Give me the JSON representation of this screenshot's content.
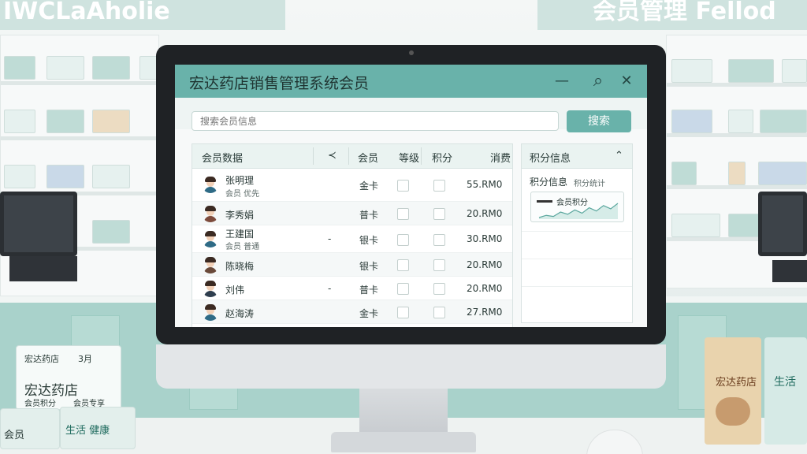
{
  "scene": {
    "sign_left": "IWCLaAholie",
    "sign_right": "会员管理 Fellod",
    "card": {
      "brand": "宏达药店",
      "logo_text": "宏达药店",
      "date": "3月",
      "footer_left": "会员积分",
      "footer_right": "会员专享"
    },
    "boxes": [
      "生活 健康",
      "会员"
    ],
    "product_left": "宏达药店",
    "product_right": "生活"
  },
  "app": {
    "title": "宏达药店销售管理系统会员",
    "minimize_icon": "—",
    "search_icon": "⌕",
    "close_icon": "✕",
    "search": {
      "placeholder": "搜索会员信息",
      "button": "搜索"
    },
    "members": {
      "header": {
        "title": "会员数据",
        "sort_icon": "≺",
        "col_member": "会员",
        "col_level": "等级",
        "col_points": "积分",
        "col_amount": "消费"
      },
      "rows": [
        {
          "name": "张明理",
          "sub": "会员 优先",
          "dash": "",
          "level": "金卡",
          "amount": "55.RM0"
        },
        {
          "name": "李秀娟",
          "sub": "",
          "dash": "",
          "level": "普卡",
          "amount": "20.RM0"
        },
        {
          "name": "王建国",
          "sub": "会员 普通",
          "dash": "-",
          "level": "银卡",
          "amount": "30.RM0"
        },
        {
          "name": "陈晓梅",
          "sub": "",
          "dash": "",
          "level": "银卡",
          "amount": "20.RM0"
        },
        {
          "name": "刘伟",
          "sub": "",
          "dash": "-",
          "level": "普卡",
          "amount": "20.RM0"
        },
        {
          "name": "赵海涛",
          "sub": "",
          "dash": "",
          "level": "金卡",
          "amount": "27.RM0"
        }
      ]
    },
    "points": {
      "title": "积分信息",
      "collapse_icon": "⌃",
      "subtitle": "积分信息",
      "subtitle_extra": "积分统计",
      "legend": "会员积分",
      "trend": [
        6,
        8,
        7,
        11,
        9,
        13,
        10,
        15,
        12,
        17,
        14,
        19
      ]
    }
  }
}
